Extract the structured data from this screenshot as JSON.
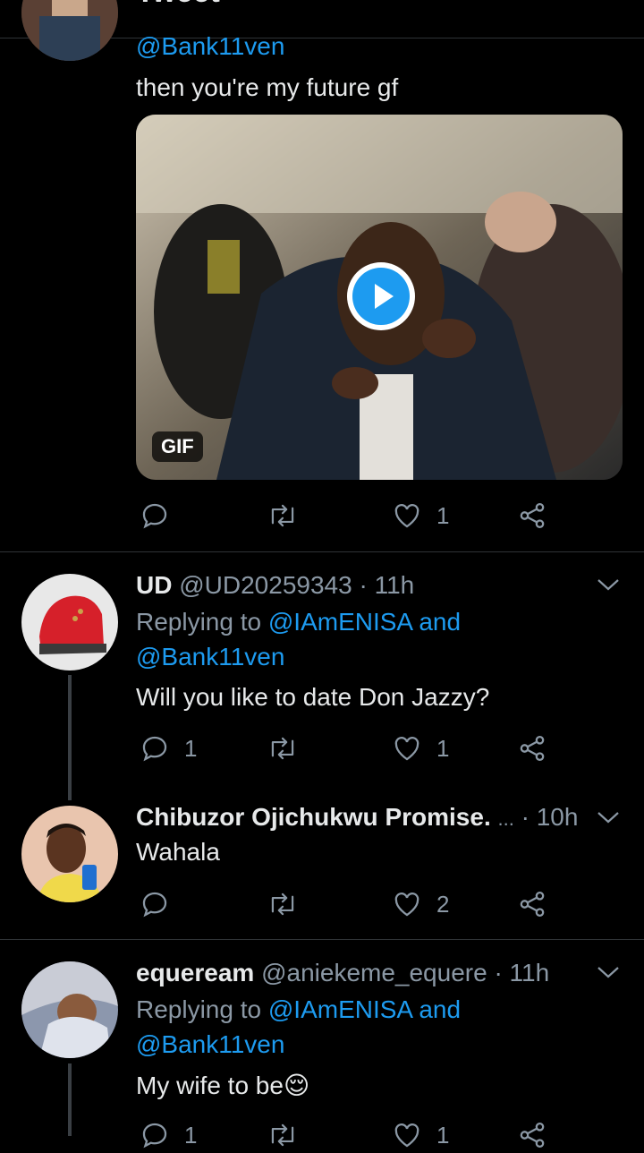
{
  "header": {
    "title": "Tweet",
    "back_icon": "arrow-left-icon"
  },
  "first_reply": {
    "handle": "@Bank11ven",
    "text": "then you're my future gf",
    "media": {
      "badge": "GIF",
      "play_icon": "play-icon"
    },
    "actions": {
      "reply_count": "",
      "retweet_count": "",
      "like_count": "1"
    }
  },
  "replies": [
    {
      "name": "UD",
      "handle": "@UD20259343",
      "time": "· 11h",
      "replying_prefix": "Replying to",
      "replying_to_1": "@IAmENISA and",
      "replying_to_2": "@Bank11ven",
      "text": "Will you like to date Don Jazzy?",
      "reply_count": "1",
      "retweet_count": "",
      "like_count": "1"
    },
    {
      "name": "Chibuzor Ojichukwu Promise.",
      "handle": "...",
      "time": "· 10h",
      "text": "Wahala",
      "reply_count": "",
      "retweet_count": "",
      "like_count": "2"
    },
    {
      "name": "equeream",
      "handle": "@aniekeme_equere",
      "time": "· 11h",
      "replying_prefix": "Replying to",
      "replying_to_1": "@IAmENISA and",
      "replying_to_2": "@Bank11ven",
      "text": "My wife to be😌",
      "reply_count": "1",
      "retweet_count": "",
      "like_count": "1"
    }
  ],
  "colors": {
    "accent": "#1d9bf0",
    "background": "#000000",
    "muted": "#8b98a5",
    "divider": "#2f3336"
  }
}
